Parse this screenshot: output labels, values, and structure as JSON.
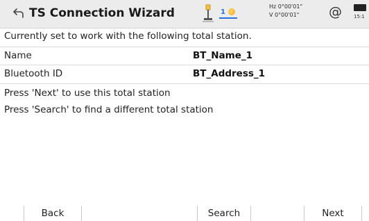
{
  "header": {
    "title": "TS Connection Wizard",
    "prism_constant": "1",
    "hz_angle": "Hz 0°00'01\"",
    "v_angle": "V  0°00'01\"",
    "at_symbol": "@",
    "battery_time": "15:1"
  },
  "intro_text": "Currently set to work with the following total station.",
  "fields": [
    {
      "label": "Name",
      "value": "BT_Name_1"
    },
    {
      "label": "Bluetooth ID",
      "value": "BT_Address_1"
    }
  ],
  "instructions": [
    "Press 'Next' to use this total station",
    "Press 'Search' to find a different total station"
  ],
  "softkeys": {
    "back": "Back",
    "search": "Search",
    "next": "Next"
  }
}
